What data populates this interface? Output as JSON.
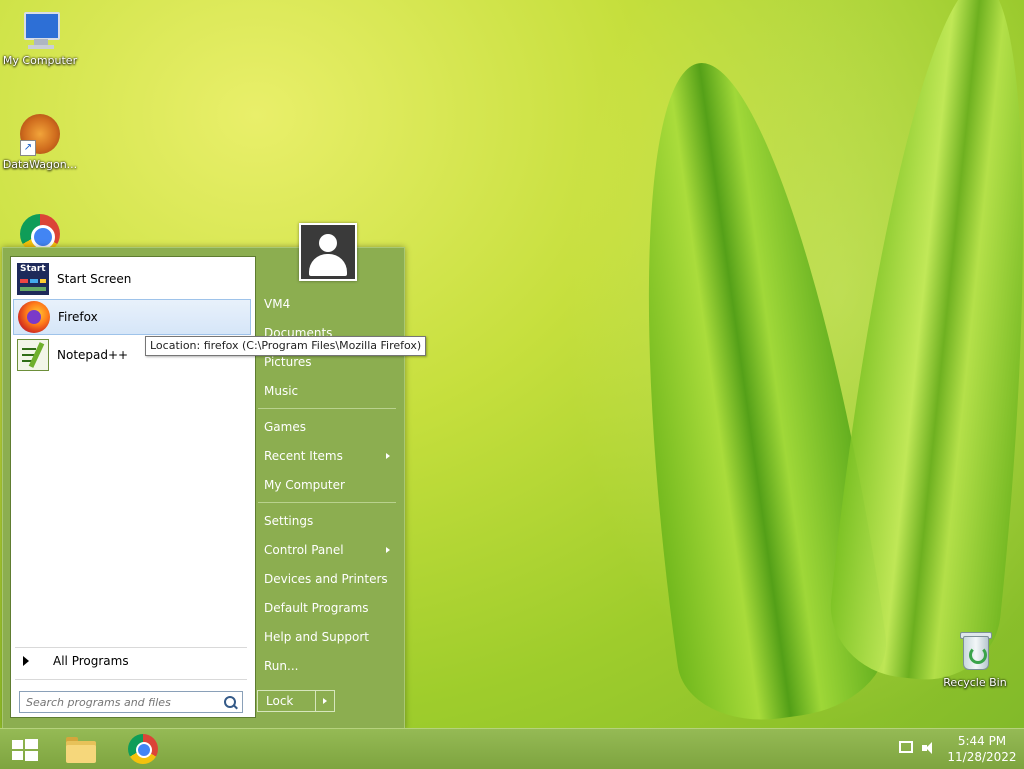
{
  "desktop": {
    "icons": [
      {
        "label": "My Computer"
      },
      {
        "label": "DataWagon..."
      },
      {
        "label": "Recycle Bin"
      }
    ]
  },
  "start_menu": {
    "pinned": [
      {
        "label": "Start Screen",
        "icon": "start-screen-icon"
      },
      {
        "label": "Firefox",
        "icon": "firefox-icon",
        "hovered": true
      },
      {
        "label": "Notepad++",
        "icon": "notepad-plus-plus-icon"
      }
    ],
    "tooltip": "Location: firefox (C:\\Program Files\\Mozilla Firefox)",
    "all_programs": "All Programs",
    "search_placeholder": "Search programs and files",
    "right": {
      "user": "VM4",
      "items": [
        "Documents",
        "Pictures",
        "Music",
        "Games",
        "Recent Items",
        "My Computer",
        "Settings",
        "Control Panel",
        "Devices and Printers",
        "Default Programs",
        "Help and Support",
        "Run..."
      ],
      "lock": "Lock"
    }
  },
  "taskbar": {
    "time": "5:44 PM",
    "date": "11/28/2022"
  },
  "colors": {
    "menu_green": "#8cae50",
    "taskbar_green": "#86ab47"
  }
}
